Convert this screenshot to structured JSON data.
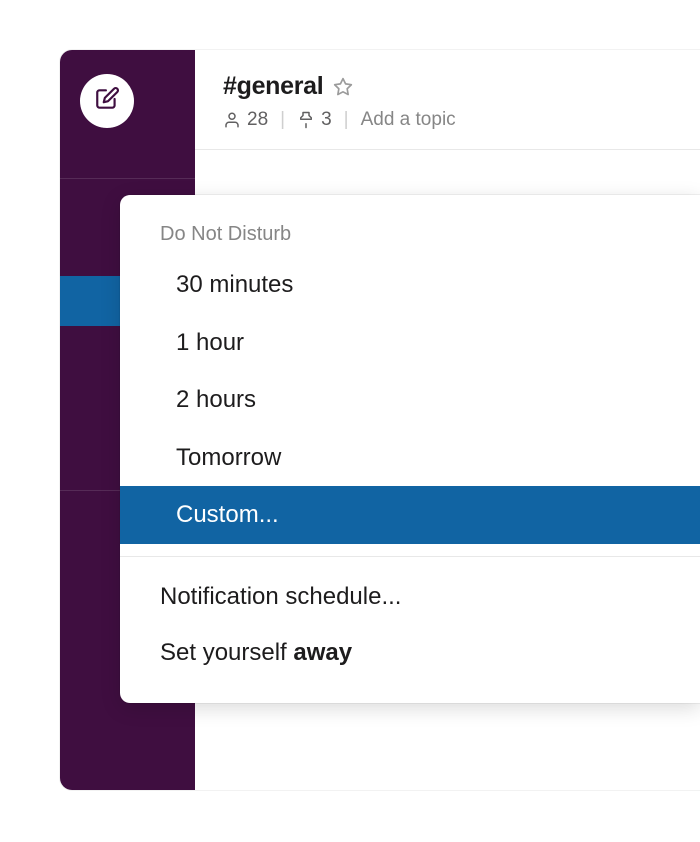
{
  "colors": {
    "sidebar": "#3f0e40",
    "highlight": "#1164a3"
  },
  "channel": {
    "name": "#general",
    "members": "28",
    "pins": "3",
    "topic_placeholder": "Add a topic"
  },
  "menu": {
    "header": "Do Not Disturb",
    "items": [
      {
        "label": "30 minutes",
        "selected": false
      },
      {
        "label": "1 hour",
        "selected": false
      },
      {
        "label": "2 hours",
        "selected": false
      },
      {
        "label": "Tomorrow",
        "selected": false
      },
      {
        "label": "Custom...",
        "selected": true
      }
    ],
    "notification_schedule": "Notification schedule...",
    "set_away_prefix": "Set yourself ",
    "set_away_bold": "away"
  }
}
